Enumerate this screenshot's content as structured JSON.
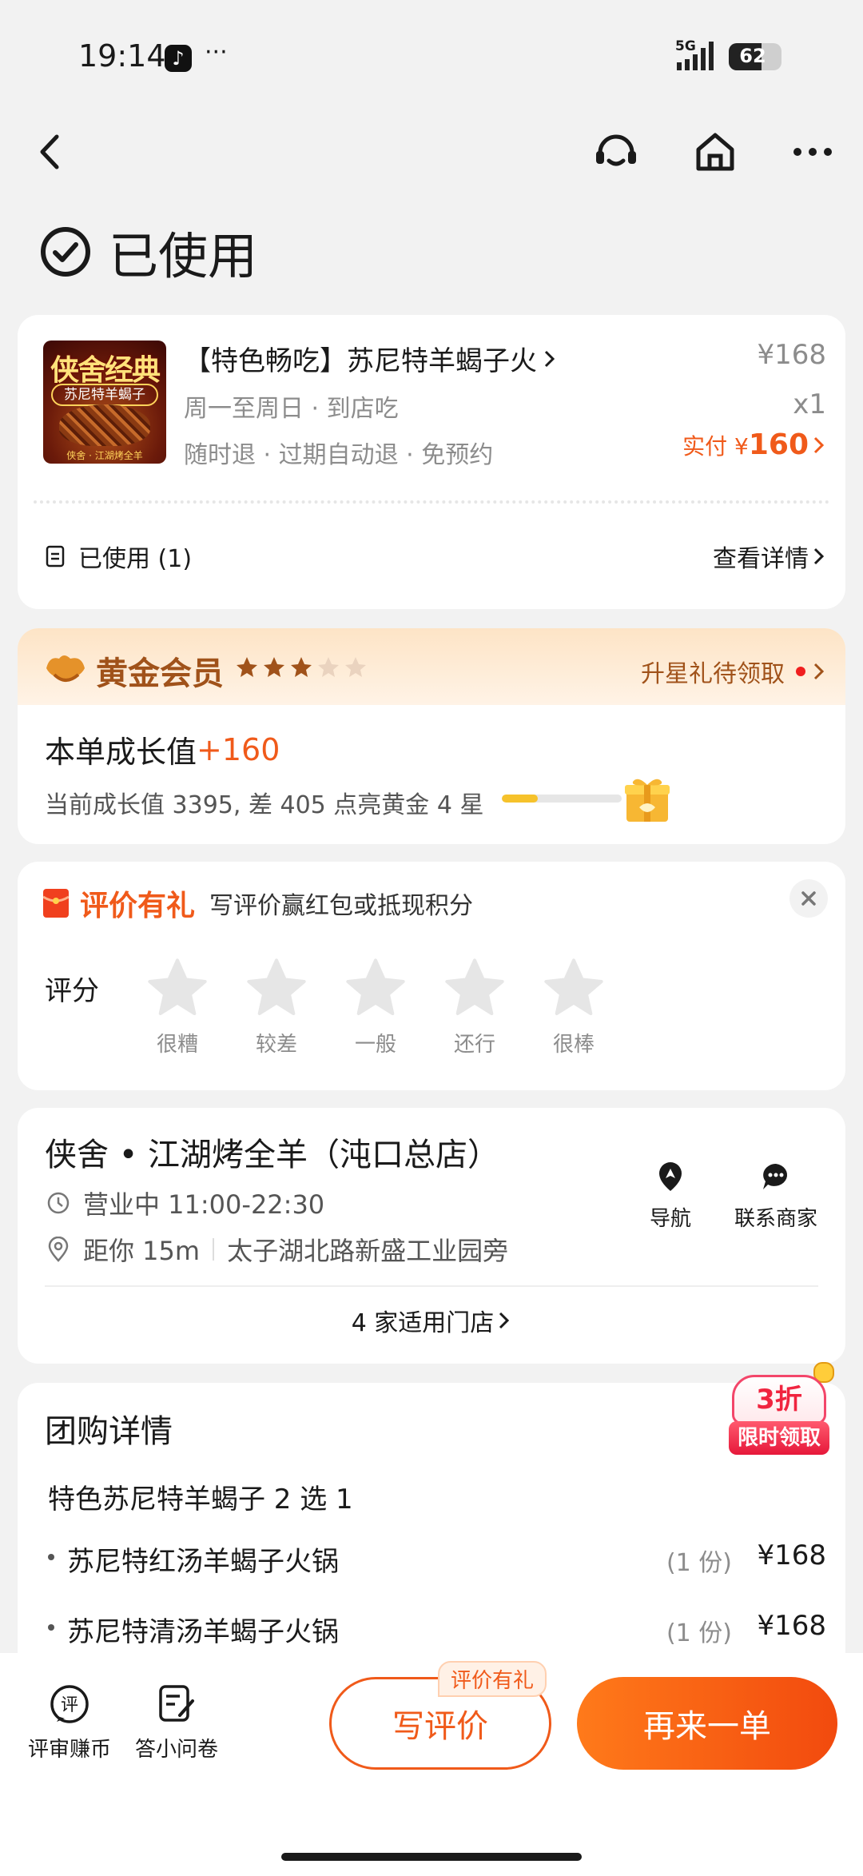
{
  "status": {
    "time": "19:14",
    "more": "···",
    "signal_label": "5G",
    "battery": "62"
  },
  "page": {
    "title": "已使用"
  },
  "product": {
    "name": "【特色畅吃】苏尼特羊蝎子火",
    "tags_line1": "周一至周日 · 到店吃",
    "tags_line2": "随时退 · 过期自动退 · 免预约",
    "price": "¥168",
    "qty": "x1",
    "paid_label": "实付 ¥",
    "paid_value": "160",
    "thumb_title": "侠舍经典",
    "thumb_sub": "苏尼特羊蝎子",
    "thumb_foot": "侠舍 · 江湖烤全羊",
    "used_label": "已使用 (1)",
    "detail_link": "查看详情"
  },
  "member": {
    "level": "黄金会员",
    "stars_filled": 3,
    "stars_total": 5,
    "upgrade": "升星礼待领取",
    "growth_label": "本单成长值",
    "growth_value": "+160",
    "progress_text": "当前成长值 3395, 差 405 点亮黄金 4 星",
    "progress_fraction": 0.3
  },
  "review": {
    "title": "评价有礼",
    "subtitle": "写评价赢红包或抵现积分",
    "score_label": "评分",
    "levels": [
      "很糟",
      "较差",
      "一般",
      "还行",
      "很棒"
    ]
  },
  "store": {
    "name": "侠舍 • 江湖烤全羊（沌口总店）",
    "hours": "营业中 11:00-22:30",
    "distance": "距你 15m",
    "address": "太子湖北路新盛工业园旁",
    "nav_label": "导航",
    "contact_label": "联系商家",
    "stores_link": "4 家适用门店"
  },
  "deal": {
    "title": "团购详情",
    "subtitle": "特色苏尼特羊蝎子 2 选 1",
    "items": [
      {
        "name": "苏尼特红汤羊蝎子火锅",
        "qty": "(1 份)",
        "price": "¥168"
      },
      {
        "name": "苏尼特清汤羊蝎子火锅",
        "qty": "(1 份)",
        "price": "¥168"
      }
    ],
    "promo_main": "3折",
    "promo_sub": "限时领取"
  },
  "bottom": {
    "earn_label": "评审赚币",
    "survey_label": "答小问卷",
    "write_review": "写评价",
    "review_badge": "评价有礼",
    "reorder": "再来一单"
  },
  "colors": {
    "accent": "#f05a1a",
    "gold": "#a0521a",
    "background": "#f2f2f2"
  }
}
